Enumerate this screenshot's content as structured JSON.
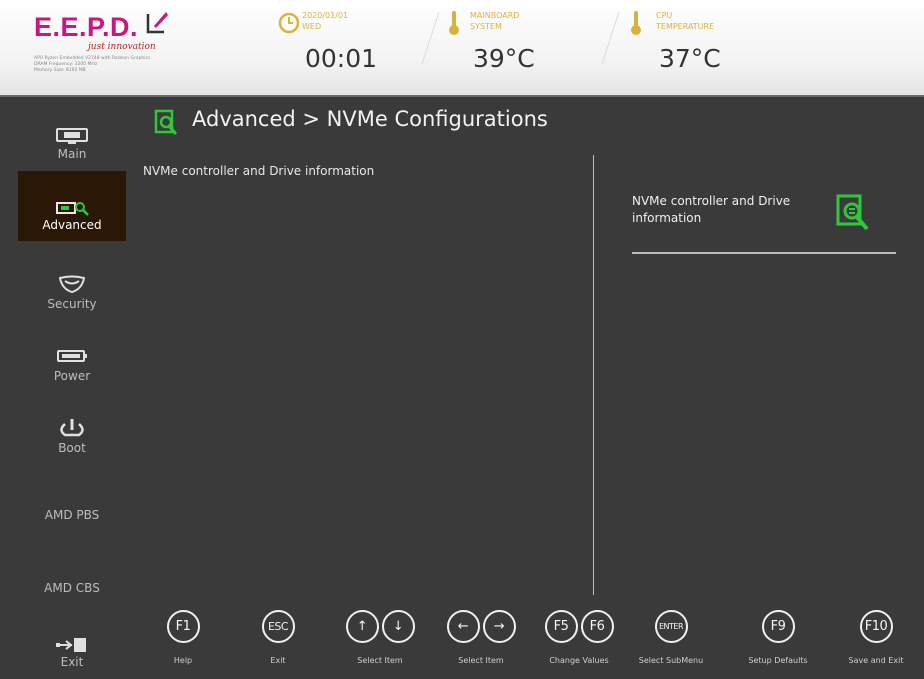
{
  "header": {
    "brand": "E.E.P.D.",
    "tagline": "just innovation",
    "sysinfo": [
      "APU Ryzen Embedded V2748 with Radeon Graphics",
      "DRAM Frequency: 3200 MHz",
      "Memory Size: 8192 MB"
    ],
    "clock": {
      "label_line1": "2020/01/01",
      "label_line2": "WED",
      "value": "00:01"
    },
    "mainboard": {
      "label_line1": "MAINBOARD",
      "label_line2": "SYSTEM",
      "value": "39°C"
    },
    "cpu": {
      "label_line1": "CPU",
      "label_line2": "TEMPERATURE",
      "value": "37°C"
    },
    "brand_color": "#c8177f",
    "accent_color": "#d9b23b"
  },
  "sidebar": {
    "items": [
      {
        "label": "Main",
        "icon": "monitor-icon",
        "active": false
      },
      {
        "label": "Advanced",
        "icon": "advanced-chip-icon",
        "active": true
      },
      {
        "label": "Security",
        "icon": "shield-icon",
        "active": false
      },
      {
        "label": "Power",
        "icon": "battery-icon",
        "active": false
      },
      {
        "label": "Boot",
        "icon": "power-icon",
        "active": false
      },
      {
        "label": "AMD PBS"
      },
      {
        "label": "AMD CBS"
      },
      {
        "label": "Exit",
        "icon": "exit-door-icon"
      }
    ]
  },
  "main": {
    "title": "Advanced > NVMe Configurations",
    "section_label": "NVMe controller and Drive information"
  },
  "help": {
    "text": "NVMe controller and Drive information",
    "icon": "document-search-icon"
  },
  "footer": {
    "keys": [
      {
        "keys": [
          "F1"
        ],
        "caption": "Help"
      },
      {
        "keys": [
          "ESC"
        ],
        "caption": "Exit"
      },
      {
        "keys": [
          "↑",
          "↓"
        ],
        "caption": "Select Item"
      },
      {
        "keys": [
          "←",
          "→"
        ],
        "caption": "Select Item"
      },
      {
        "keys": [
          "F5",
          "F6"
        ],
        "caption": "Change Values"
      },
      {
        "keys": [
          "ENTER"
        ],
        "caption": "Select SubMenu"
      },
      {
        "keys": [
          "F9"
        ],
        "caption": "Setup Defaults"
      },
      {
        "keys": [
          "F10"
        ],
        "caption": "Save and Exit"
      }
    ]
  },
  "colors": {
    "background": "#3a3a3a",
    "active_item": "#2b1705",
    "green_icon": "#2fc83c"
  }
}
